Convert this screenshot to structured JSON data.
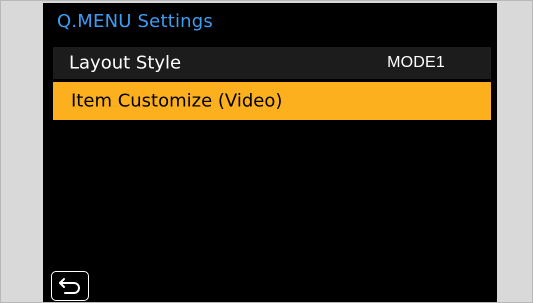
{
  "menu": {
    "title": "Q.MENU Settings",
    "items": [
      {
        "label": "Layout Style",
        "value": "MODE1",
        "selected": false
      },
      {
        "label": "Item Customize (Video)",
        "value": "",
        "selected": true
      }
    ]
  },
  "footer": {
    "back_icon": "return-arrow-icon"
  },
  "colors": {
    "title": "#3e9df2",
    "highlight": "#fdb01e",
    "screen_bg": "#000000",
    "row_bg": "#1c1c1c",
    "frame_bg": "#d9d9d9"
  }
}
